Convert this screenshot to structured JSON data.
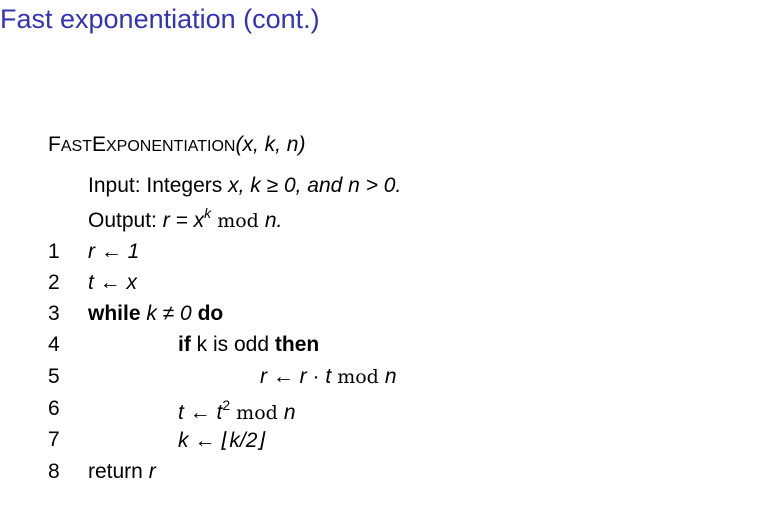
{
  "slide": {
    "title": "Fast exponentiation (cont.)"
  },
  "algorithm": {
    "name_first": "F",
    "name_smallcaps1": "AST",
    "name_cap2": "E",
    "name_smallcaps2": "XPONENTIATION",
    "params": "(x, k, n)",
    "input_label": "Input: Integers ",
    "input_expr": "x, k ≥ 0, and n > 0.",
    "output_label": "Output: ",
    "output_expr_a": "r = x",
    "output_expr_sup": "k",
    "output_expr_mod": " mod ",
    "output_expr_b": "n.",
    "lines": [
      {
        "num": "1",
        "text": "r ← 1"
      },
      {
        "num": "2",
        "text": "t ← x"
      },
      {
        "num": "3",
        "kw1": "while",
        "mid": " k ≠ 0 ",
        "kw2": "do"
      },
      {
        "num": "4",
        "kw1": "if",
        "mid": " k is odd ",
        "kw2": "then"
      },
      {
        "num": "5",
        "a": "r ← r · t",
        "mod": " mod ",
        "b": "n"
      },
      {
        "num": "6",
        "a": "t ← t",
        "sup": "2",
        "mod": " mod ",
        "b": "n"
      },
      {
        "num": "7",
        "text": "k ← ⌊k/2⌋"
      },
      {
        "num": "8",
        "plain": "return ",
        "var": "r"
      }
    ]
  }
}
